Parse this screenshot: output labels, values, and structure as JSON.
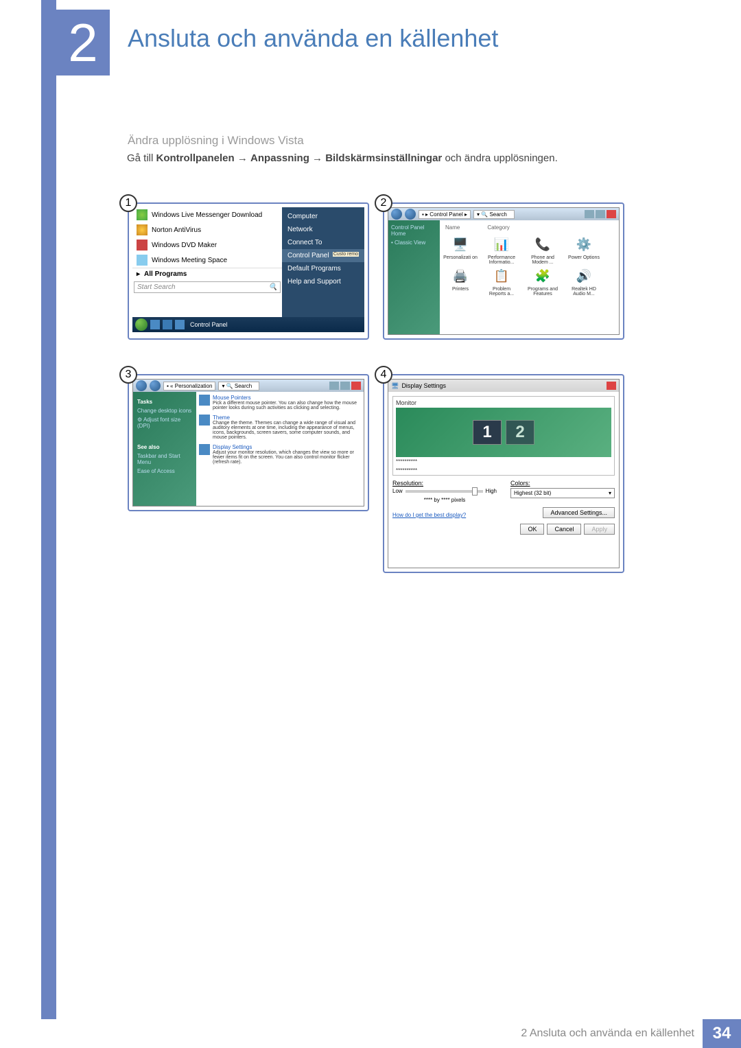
{
  "chapter_number": "2",
  "chapter_title": "Ansluta och använda en källenhet",
  "subtitle": "Ändra upplösning i Windows Vista",
  "body": {
    "prefix": "Gå till ",
    "b1": "Kontrollpanelen",
    "arr": " → ",
    "b2": "Anpassning",
    "b3": "Bildskärmsinställningar",
    "suffix": " och ändra upplösningen."
  },
  "step_numbers": [
    "1",
    "2",
    "3",
    "4"
  ],
  "startmenu": {
    "items": [
      "Windows Live Messenger Download",
      "Norton AntiVirus",
      "Windows DVD Maker",
      "Windows Meeting Space"
    ],
    "all_programs": "All Programs",
    "search": "Start Search",
    "right": [
      "Computer",
      "Network",
      "Connect To",
      "Control Panel",
      "Default Programs",
      "Help and Support"
    ],
    "right_hint": "Custo remo",
    "taskbar_cp": "Control Panel"
  },
  "cp": {
    "bc": "Control Panel",
    "search_ph": "Search",
    "side_home": "Control Panel Home",
    "side_classic": "Classic View",
    "cols": {
      "name": "Name",
      "category": "Category"
    },
    "items": [
      {
        "icon": "🖥️",
        "label": "Personalizati on"
      },
      {
        "icon": "📊",
        "label": "Performance Informatio..."
      },
      {
        "icon": "📞",
        "label": "Phone and Modem ..."
      },
      {
        "icon": "⚙️",
        "label": "Power Options"
      },
      {
        "icon": "🖨️",
        "label": "Printers"
      },
      {
        "icon": "📋",
        "label": "Problem Reports a..."
      },
      {
        "icon": "🧩",
        "label": "Programs and Features"
      },
      {
        "icon": "🔊",
        "label": "Realtek HD Audio M..."
      }
    ]
  },
  "pz": {
    "bc": "Personalization",
    "search_ph": "Search",
    "tasks": "Tasks",
    "task_links": [
      "Change desktop icons",
      "Adjust font size (DPI)"
    ],
    "see_also": "See also",
    "see_links": [
      "Taskbar and Start Menu",
      "Ease of Access"
    ],
    "items": [
      {
        "title": "Mouse Pointers",
        "desc": "Pick a different mouse pointer. You can also change how the mouse pointer looks during such activities as clicking and selecting."
      },
      {
        "title": "Theme",
        "desc": "Change the theme. Themes can change a wide range of visual and auditory elements at one time, including the appearance of menus, icons, backgrounds, screen savers, some computer sounds, and mouse pointers."
      },
      {
        "title": "Display Settings",
        "desc": "Adjust your monitor resolution, which changes the view so more or fewer items fit on the screen. You can also control monitor flicker (refresh rate)."
      }
    ]
  },
  "ds": {
    "title": "Display Settings",
    "monitor": "Monitor",
    "m1": "1",
    "m2": "2",
    "asterisks": "**********",
    "res": "Resolution:",
    "low": "Low",
    "high": "High",
    "pixels": "**** by **** pixels",
    "colors": "Colors:",
    "colors_val": "Highest (32 bit)",
    "help": "How do I get the best display?",
    "adv": "Advanced Settings...",
    "ok": "OK",
    "cancel": "Cancel",
    "apply": "Apply"
  },
  "footer": {
    "label": "2 Ansluta och använda en källenhet",
    "page": "34"
  }
}
